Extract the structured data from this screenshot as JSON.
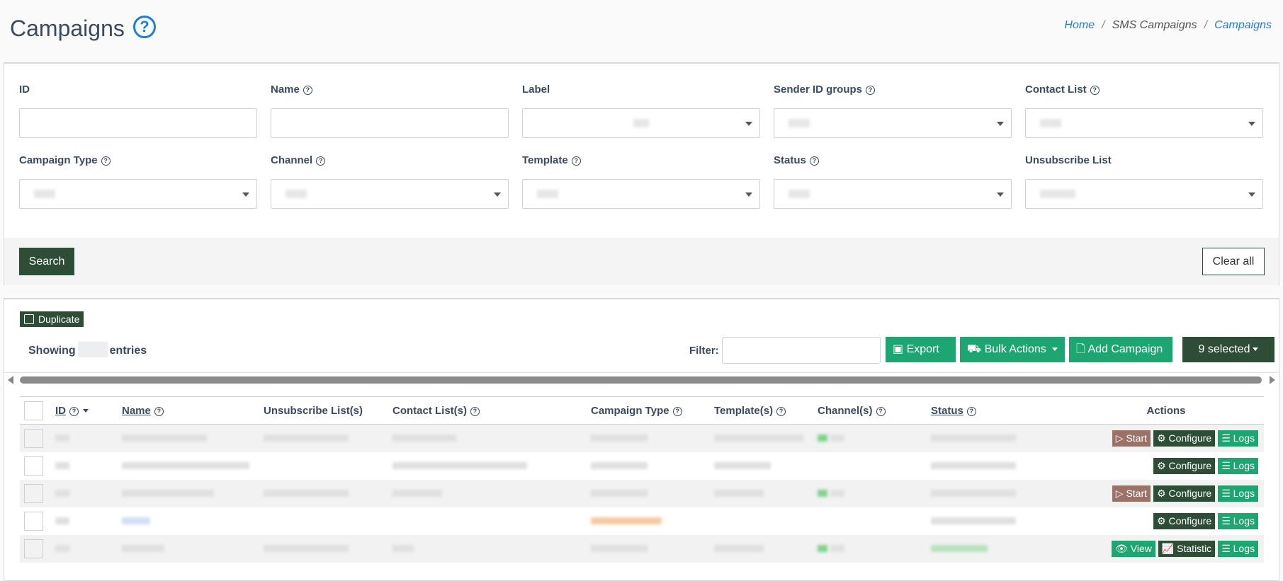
{
  "header": {
    "title": "Campaigns",
    "breadcrumb": {
      "home": "Home",
      "sep": "/",
      "section": "SMS Campaigns",
      "current": "Campaigns"
    }
  },
  "filters": {
    "row1": [
      {
        "label": "ID",
        "help": false,
        "type": "input"
      },
      {
        "label": "Name",
        "help": true,
        "type": "input"
      },
      {
        "label": "Label",
        "help": false,
        "type": "select"
      },
      {
        "label": "Sender ID groups",
        "help": true,
        "type": "select"
      },
      {
        "label": "Contact List",
        "help": true,
        "type": "select"
      }
    ],
    "row2": [
      {
        "label": "Campaign Type",
        "help": true,
        "type": "select"
      },
      {
        "label": "Channel",
        "help": true,
        "type": "select"
      },
      {
        "label": "Template",
        "help": true,
        "type": "select"
      },
      {
        "label": "Status",
        "help": true,
        "type": "select"
      },
      {
        "label": "Unsubscribe List",
        "help": false,
        "type": "select"
      }
    ],
    "search_label": "Search",
    "clear_label": "Clear all"
  },
  "toolbar": {
    "duplicate_label": "Duplicate",
    "showing_prefix": "Showing",
    "showing_suffix": "entries",
    "filter_label": "Filter:",
    "export_label": "Export",
    "bulk_label": "Bulk Actions",
    "add_label": "Add Campaign",
    "selected_label": "9 selected"
  },
  "table": {
    "columns": [
      "ID",
      "Name",
      "Unsubscribe List(s)",
      "Contact List(s)",
      "Campaign Type",
      "Template(s)",
      "Channel(s)",
      "Status",
      "Actions"
    ],
    "action_labels": {
      "start": "Start",
      "configure": "Configure",
      "logs": "Logs",
      "view": "View",
      "statistic": "Statistic"
    },
    "rows": [
      {
        "actions": [
          "start",
          "configure",
          "logs"
        ],
        "striped": true
      },
      {
        "actions": [
          "configure",
          "logs"
        ],
        "striped": false
      },
      {
        "actions": [
          "start",
          "configure",
          "logs"
        ],
        "striped": true
      },
      {
        "actions": [
          "configure",
          "logs"
        ],
        "striped": false
      },
      {
        "actions": [
          "view",
          "statistic",
          "logs"
        ],
        "striped": true
      }
    ]
  },
  "colors": {
    "primary_dark": "#2e4d36",
    "green": "#1ea672",
    "start_brown": "#9a7268",
    "link_blue": "#1e7fd9"
  }
}
